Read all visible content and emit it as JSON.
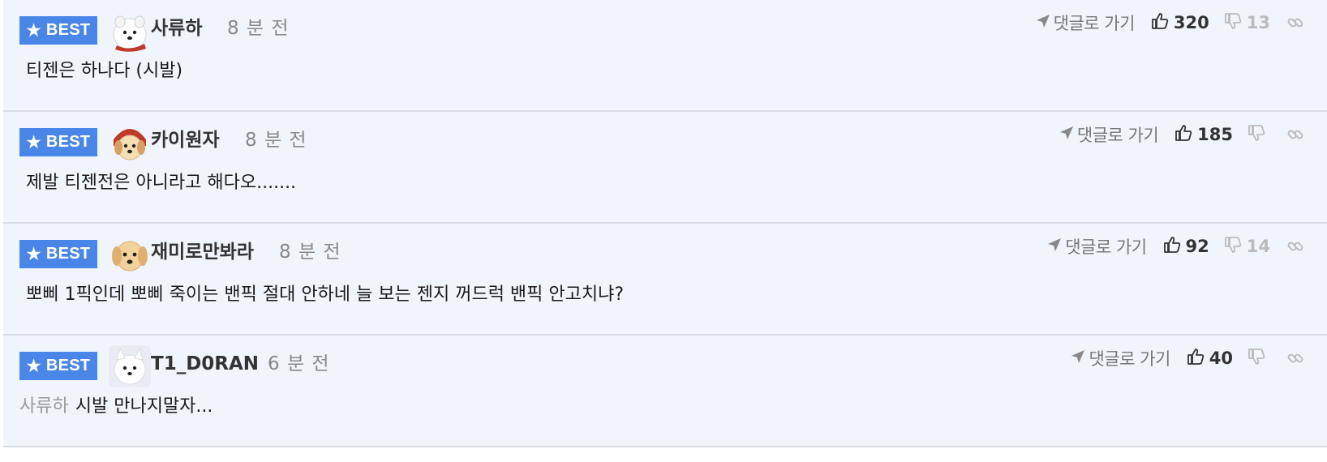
{
  "comments": [
    {
      "badge": "BEST",
      "username": "사류하",
      "time": "8 분 전",
      "goto_label": "댓글로 가기",
      "likes": "320",
      "dislikes": "13",
      "mention": "",
      "text": "티젠은 하나다 (시발)"
    },
    {
      "badge": "BEST",
      "username": "카이원자",
      "time": "8 분 전",
      "goto_label": "댓글로 가기",
      "likes": "185",
      "dislikes": "",
      "mention": "",
      "text": "제발 티젠전은 아니라고 해다오......."
    },
    {
      "badge": "BEST",
      "username": "재미로만봐라",
      "time": "8 분 전",
      "goto_label": "댓글로 가기",
      "likes": "92",
      "dislikes": "14",
      "mention": "",
      "text": "뽀삐 1픽인데 뽀삐 죽이는 밴픽 절대 안하네 늘 보는 젠지 꺼드럭 밴픽 안고치냐?"
    },
    {
      "badge": "BEST",
      "username": "T1_D0RAN",
      "time": "6 분 전",
      "goto_label": "댓글로 가기",
      "likes": "40",
      "dislikes": "",
      "mention": "사류하",
      "text": "시발 만나지말자..."
    }
  ],
  "icons": {
    "badge": "star-icon",
    "goto": "send-arrow-icon",
    "like": "thumbs-up-icon",
    "dislike": "thumbs-down-icon",
    "link": "link-icon"
  },
  "colors": {
    "badge_bg": "#4a86e8",
    "row_bg": "#f0f4fb",
    "muted": "#888888"
  }
}
